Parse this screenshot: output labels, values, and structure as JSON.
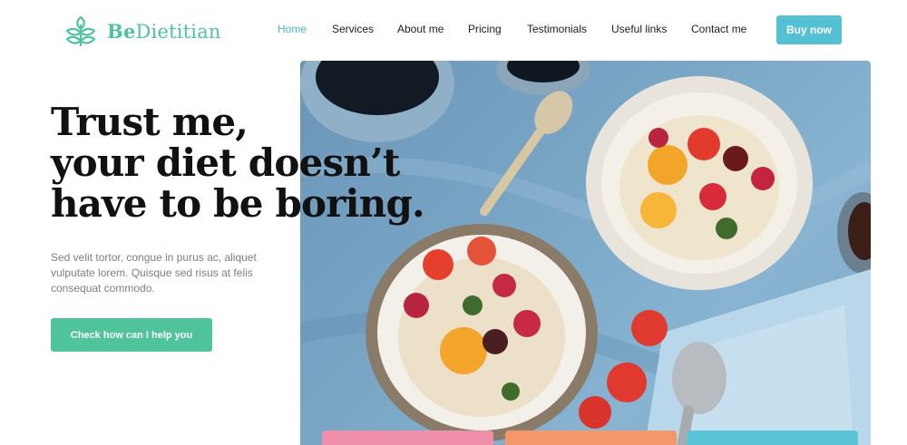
{
  "brand": {
    "name_prefix": "Be",
    "name_suffix": "Dietitian",
    "accent_color": "#4fc49c"
  },
  "nav": {
    "items": [
      {
        "label": "Home",
        "active": true
      },
      {
        "label": "Services",
        "active": false
      },
      {
        "label": "About me",
        "active": false
      },
      {
        "label": "Pricing",
        "active": false
      },
      {
        "label": "Testimonials",
        "active": false
      },
      {
        "label": "Useful links",
        "active": false
      },
      {
        "label": "Contact me",
        "active": false
      }
    ],
    "buy_label": "Buy now",
    "active_color": "#4ab8c8",
    "button_color": "#54c0d4"
  },
  "hero": {
    "headline_line1": "Trust me,",
    "headline_line2": "your diet doesn’t",
    "headline_line3": "have to be boring.",
    "description": "Sed velit tortor, congue in purus ac, aliquet vulputate lorem. Quisque sed risus at felis consequat commodo.",
    "cta_label": "Check how can I help you",
    "image_icon": "food-bowls-photo"
  },
  "cards": {
    "colors": [
      "#ef8fab",
      "#f4986a",
      "#5bc4d6"
    ]
  }
}
